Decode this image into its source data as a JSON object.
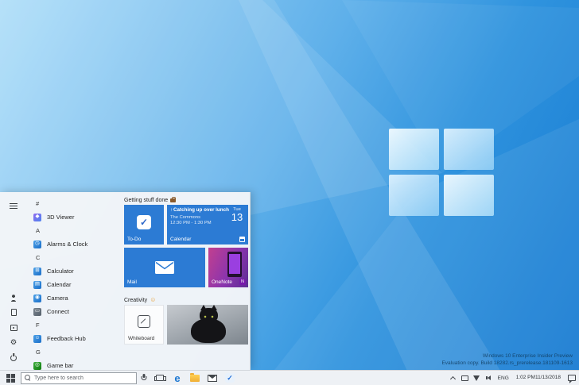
{
  "desktop": {
    "watermark": {
      "line1": "Windows 10 Enterprise Insider Preview",
      "line2": "Evaluation copy. Build 18282.rs_prerelease.181109-1613"
    },
    "colors": {
      "accent_blue": "#2c7bd4",
      "wallpaper_deep": "#1478d0",
      "wallpaper_light": "#aedef9"
    }
  },
  "icons": {
    "check": "✓",
    "up_arrow": "↑",
    "smiley": "☺",
    "gear": "⚙",
    "edge": "e",
    "onenote_badge": "N"
  },
  "start_menu": {
    "app_list": [
      {
        "type": "letter",
        "label": "#"
      },
      {
        "type": "app",
        "label": "3D Viewer",
        "glyph": "◆"
      },
      {
        "type": "letter",
        "label": "A"
      },
      {
        "type": "app",
        "label": "Alarms & Clock",
        "glyph": "◷"
      },
      {
        "type": "letter",
        "label": "C"
      },
      {
        "type": "app",
        "label": "Calculator",
        "glyph": "⊞"
      },
      {
        "type": "app",
        "label": "Calendar",
        "glyph": "▤"
      },
      {
        "type": "app",
        "label": "Camera",
        "glyph": "◉"
      },
      {
        "type": "app",
        "label": "Connect",
        "glyph": "▭"
      },
      {
        "type": "letter",
        "label": "F"
      },
      {
        "type": "app",
        "label": "Feedback Hub",
        "glyph": "☺"
      },
      {
        "type": "letter",
        "label": "G"
      },
      {
        "type": "app",
        "label": "Game bar",
        "glyph": "◎"
      }
    ],
    "groups": {
      "g1": {
        "title": "Getting stuff done"
      },
      "g2": {
        "title": "Creativity"
      }
    },
    "tiles": {
      "todo": {
        "label": "To-Do"
      },
      "calendar": {
        "label": "Calendar",
        "event_title": "Catching up over lunch",
        "event_location": "The Commons",
        "event_time": "12:30 PM - 1:30 PM",
        "day_name": "Tue",
        "day_num": "13"
      },
      "mail": {
        "label": "Mail"
      },
      "onenote": {
        "label": "OneNote"
      },
      "whiteboard": {
        "label": "Whiteboard"
      }
    }
  },
  "taskbar": {
    "search_placeholder": "Type here to search",
    "tray": {
      "lang": "ENG",
      "time": "1:02 PM",
      "date": "11/13/2018"
    }
  }
}
